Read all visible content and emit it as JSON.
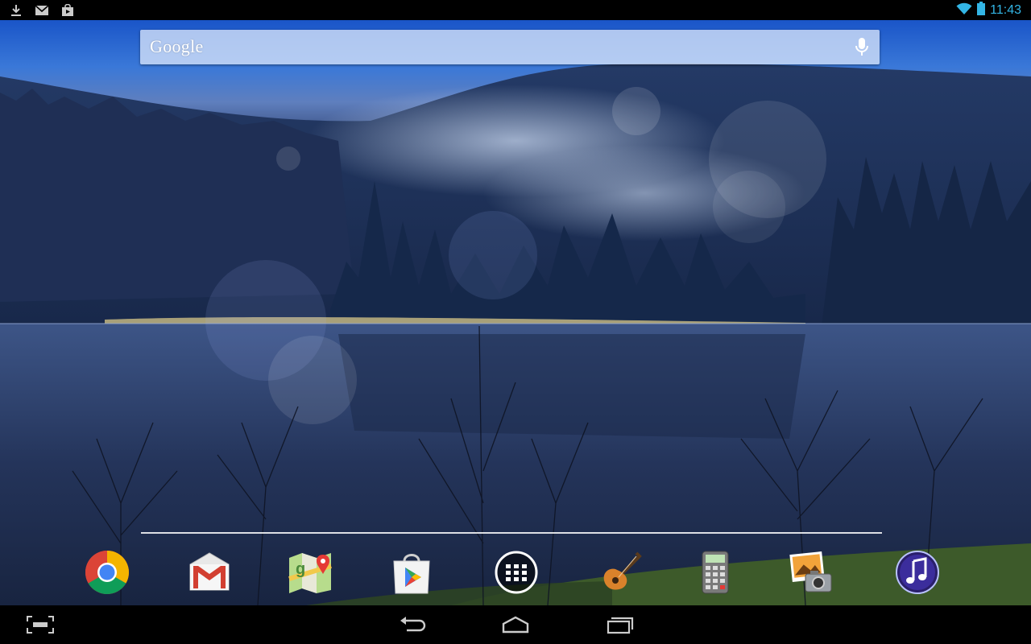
{
  "status_bar": {
    "time": "11:43",
    "notification_icons": [
      "download-icon",
      "gmail-notification-icon",
      "play-store-notification-icon"
    ],
    "system_icons": [
      "wifi-icon",
      "battery-icon"
    ],
    "accent_color": "#33b5e5"
  },
  "search": {
    "logo_text": "Google",
    "voice_icon": "mic-icon"
  },
  "dock": {
    "apps": [
      {
        "name": "chrome",
        "icon": "chrome-icon"
      },
      {
        "name": "gmail",
        "icon": "gmail-icon"
      },
      {
        "name": "maps",
        "icon": "maps-icon"
      },
      {
        "name": "play-store",
        "icon": "play-store-icon"
      },
      {
        "name": "all-apps",
        "icon": "app-drawer-icon"
      },
      {
        "name": "guitar",
        "icon": "guitar-icon"
      },
      {
        "name": "calculator",
        "icon": "calculator-icon"
      },
      {
        "name": "gallery",
        "icon": "photo-gallery-icon"
      },
      {
        "name": "music",
        "icon": "music-icon"
      }
    ]
  },
  "nav_bar": {
    "buttons": [
      "screenshot-icon",
      "back-icon",
      "home-icon",
      "recent-apps-icon"
    ]
  }
}
